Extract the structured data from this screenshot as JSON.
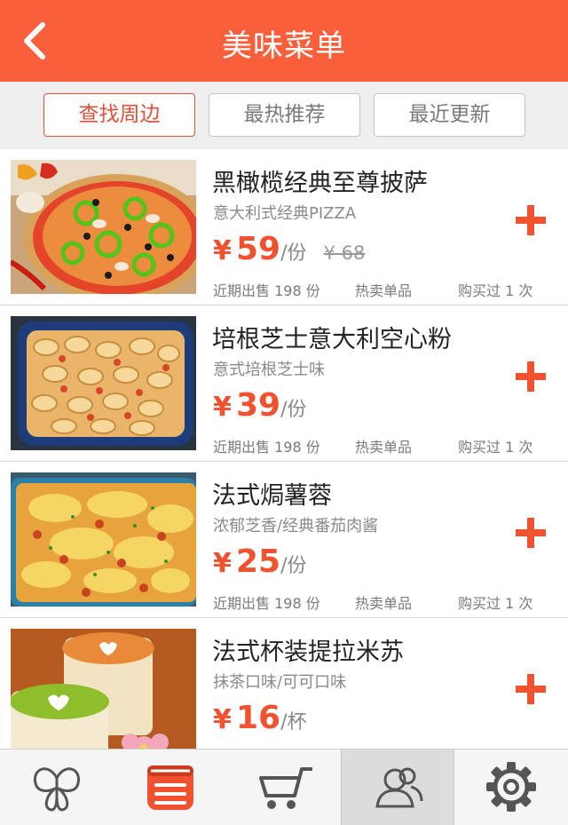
{
  "header": {
    "title": "美味菜单",
    "back_icon": "back-arrow-icon"
  },
  "tabs": [
    {
      "label": "查找周边",
      "active": true
    },
    {
      "label": "最热推荐",
      "active": false
    },
    {
      "label": "最近更新",
      "active": false
    }
  ],
  "items": [
    {
      "name": "黑橄榄经典至尊披萨",
      "desc": "意大利式经典PIZZA",
      "currency": "¥",
      "price": "59",
      "unit": "/份",
      "old_price": "¥ 68",
      "sold": "近期出售 198 份",
      "hot": "热卖单品",
      "bought": "购买过 1 次"
    },
    {
      "name": "培根芝士意大利空心粉",
      "desc": "意式培根芝士味",
      "currency": "¥",
      "price": "39",
      "unit": "/份",
      "old_price": "",
      "sold": "近期出售 198 份",
      "hot": "热卖单品",
      "bought": "购买过 1 次"
    },
    {
      "name": "法式焗薯蓉",
      "desc": "浓郁芝香/经典番茄肉酱",
      "currency": "¥",
      "price": "25",
      "unit": "/份",
      "old_price": "",
      "sold": "近期出售 198 份",
      "hot": "热卖单品",
      "bought": "购买过 1 次"
    },
    {
      "name": "法式杯装提拉米苏",
      "desc": "抹茶口味/可可口味",
      "currency": "¥",
      "price": "16",
      "unit": "/杯",
      "old_price": "",
      "sold": "",
      "hot": "",
      "bought": ""
    }
  ],
  "bottom_nav": [
    {
      "icon": "butterfly-icon",
      "active": false
    },
    {
      "icon": "menu-list-icon",
      "active": false
    },
    {
      "icon": "cart-icon",
      "active": false
    },
    {
      "icon": "user-icon",
      "active": true
    },
    {
      "icon": "gear-icon",
      "active": false
    }
  ],
  "colors": {
    "accent": "#fa5f3c",
    "price": "#f0522f"
  }
}
